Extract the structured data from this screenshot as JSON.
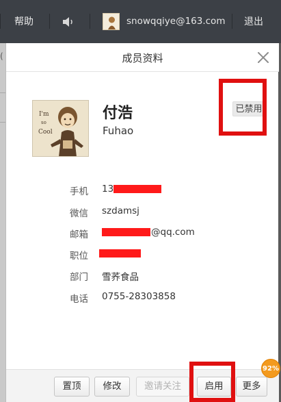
{
  "topbar": {
    "help_label": "帮助",
    "speaker_icon": "speaker-icon",
    "account_email": "snowqqiye@163.com",
    "logout_label": "退出"
  },
  "background_page": {
    "edge_text": "("
  },
  "dialog": {
    "title": "成员资料",
    "close_icon": "close-icon",
    "member": {
      "name_cn": "付浩",
      "name_en": "Fuhao",
      "status": "已禁用",
      "photo_text": "I'm so Cool"
    },
    "fields": {
      "phone_label": "手机",
      "phone_visible_prefix": "13",
      "wechat_label": "微信",
      "wechat_value": "szdamsj",
      "email_label": "邮箱",
      "email_visible_suffix": "@qq.com",
      "position_label": "职位",
      "department_label": "部门",
      "department_value": "雪荞食品",
      "tel_label": "电话",
      "tel_value": "0755-28303858"
    },
    "redaction_color": "#ff1a1a",
    "footer": {
      "pin_label": "置顶",
      "edit_label": "修改",
      "invite_label": "邀请关注",
      "enable_label": "启用",
      "more_label": "更多"
    }
  },
  "badge": {
    "percent": "92%",
    "color": "#f39a1e"
  },
  "highlight_color": "#e01010"
}
